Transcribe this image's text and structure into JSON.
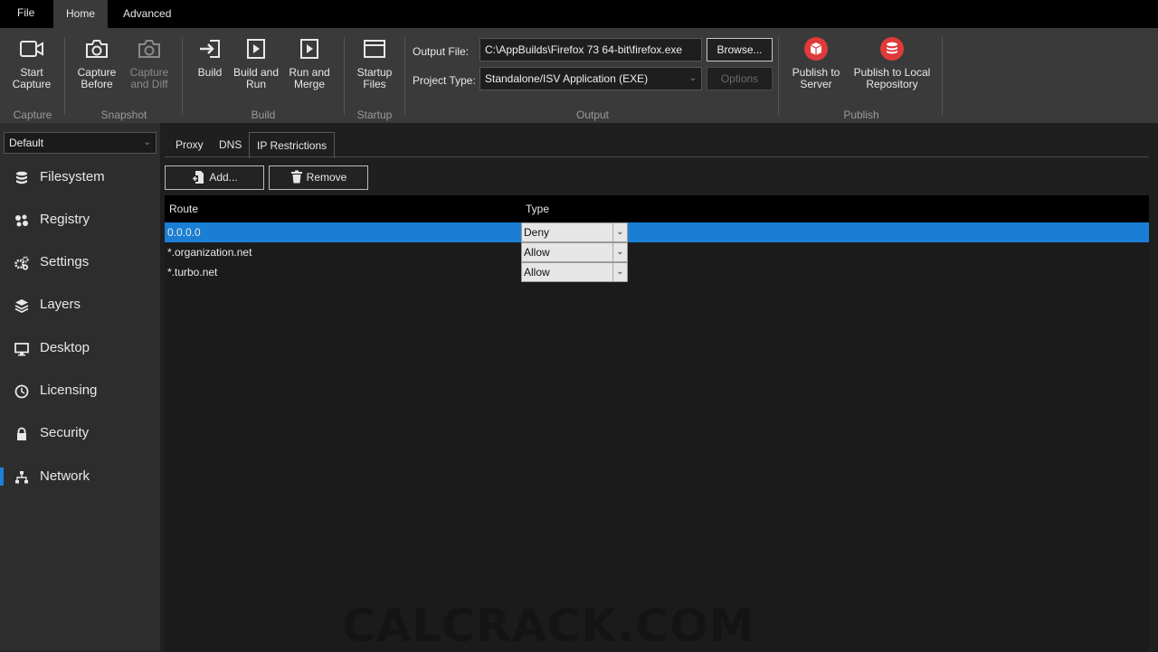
{
  "menu": {
    "file": "File",
    "home": "Home",
    "advanced": "Advanced"
  },
  "ribbon": {
    "start_capture": "Start Capture",
    "capture_before": "Capture Before",
    "capture_and_diff": "Capture and Diff",
    "build": "Build",
    "build_and_run": "Build and Run",
    "run_and_merge": "Run and Merge",
    "startup_files": "Startup Files",
    "publish_to_server": "Publish to Server",
    "publish_to_local": "Publish to Local Repository",
    "groups": {
      "capture": "Capture",
      "snapshot": "Snapshot",
      "build": "Build",
      "startup": "Startup",
      "output": "Output",
      "publish": "Publish"
    },
    "output_file_label": "Output File:",
    "output_file_value": "C:\\AppBuilds\\Firefox 73 64-bit\\firefox.exe",
    "browse": "Browse...",
    "project_type_label": "Project Type:",
    "project_type_value": "Standalone/ISV Application (EXE)",
    "options": "Options"
  },
  "sidebar": {
    "profile": "Default",
    "items": [
      {
        "label": "Filesystem",
        "icon": "database-icon"
      },
      {
        "label": "Registry",
        "icon": "registry-icon"
      },
      {
        "label": "Settings",
        "icon": "gears-icon"
      },
      {
        "label": "Layers",
        "icon": "layers-icon"
      },
      {
        "label": "Desktop",
        "icon": "monitor-icon"
      },
      {
        "label": "Licensing",
        "icon": "clock-icon"
      },
      {
        "label": "Security",
        "icon": "lock-icon"
      },
      {
        "label": "Network",
        "icon": "network-icon"
      }
    ],
    "active": "Network"
  },
  "main": {
    "tabs": [
      "Proxy",
      "DNS",
      "IP Restrictions"
    ],
    "active_tab": "IP Restrictions",
    "add": "Add...",
    "remove": "Remove",
    "columns": {
      "route": "Route",
      "type": "Type"
    },
    "rows": [
      {
        "route": "0.0.0.0",
        "type": "Deny"
      },
      {
        "route": "*.organization.net",
        "type": "Allow"
      },
      {
        "route": "*.turbo.net",
        "type": "Allow"
      }
    ]
  },
  "watermark": "CALCRACK.COM",
  "colors": {
    "accent": "#1a7fd4",
    "ribbon": "#3a3a3a",
    "sidebar": "#2d2d2d",
    "publish_red": "#e03a3a"
  }
}
